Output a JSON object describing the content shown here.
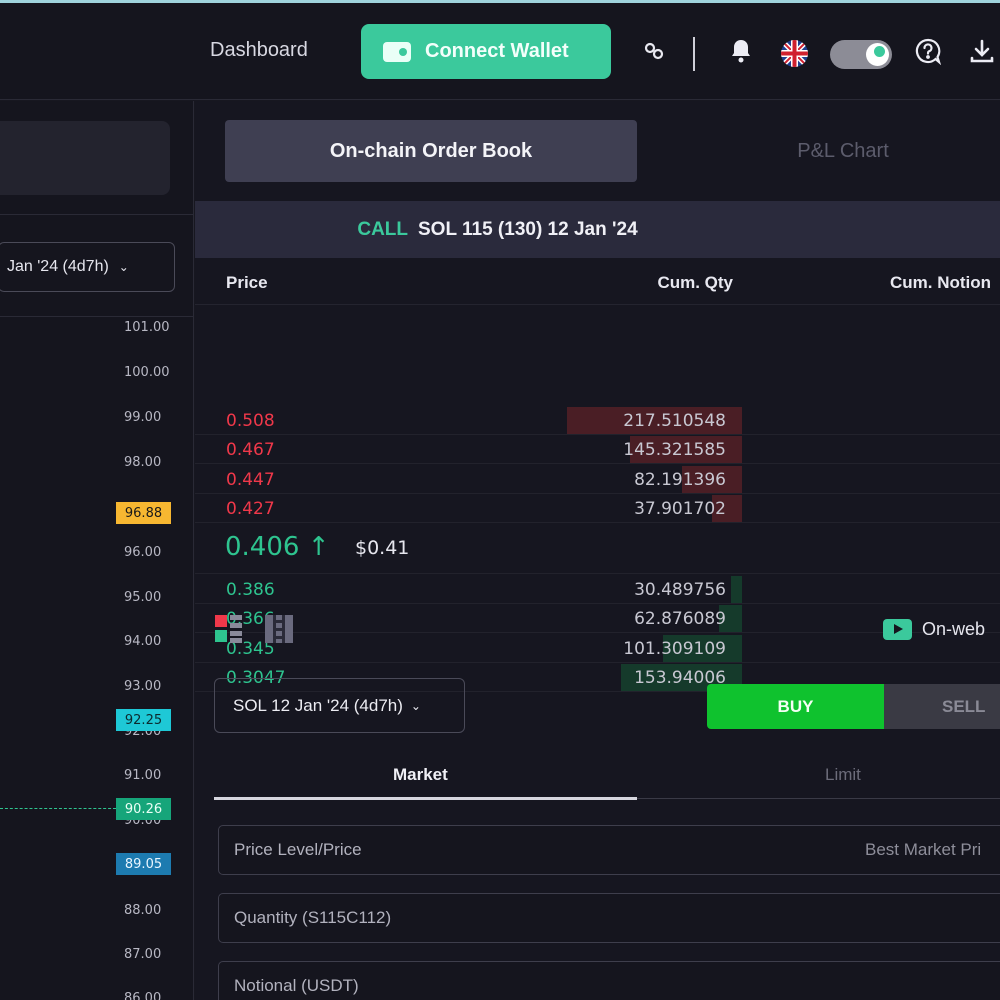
{
  "header": {
    "dashboard_label": "Dashboard",
    "connect_wallet_label": "Connect Wallet",
    "icons": [
      "link-icon",
      "bell-icon",
      "uk-flag-icon",
      "theme-toggle",
      "help-icon",
      "download-icon"
    ]
  },
  "left_panel": {
    "expiry_label": "Jan '24 (4d7h)",
    "axis_ticks": [
      "101.00",
      "100.00",
      "99.00",
      "98.00",
      "96.00",
      "95.00",
      "94.00",
      "93.00",
      "92.00",
      "91.00",
      "90.00",
      "88.00",
      "87.00",
      "86.00"
    ],
    "price_tags": [
      {
        "label": "96.88",
        "bg": "#f7b731",
        "fg": "#1a1a1a"
      },
      {
        "label": "92.25",
        "bg": "#1ec8d6",
        "fg": "#0c2a2e"
      },
      {
        "label": "90.26",
        "bg": "#16a57a",
        "fg": "#eafff6"
      },
      {
        "label": "89.05",
        "bg": "#1d7bb0",
        "fg": "#eaf6ff"
      }
    ]
  },
  "tabs": {
    "order_book": "On-chain Order Book",
    "pnl_chart": "P&L Chart"
  },
  "instrument": {
    "type": "CALL",
    "name": "SOL 115 (130) 12 Jan '24"
  },
  "order_book": {
    "columns": {
      "price": "Price",
      "cum_qty": "Cum. Qty",
      "cum_notional": "Cum. Notion"
    },
    "asks": [
      {
        "price": "0.508",
        "qty": "217.510548",
        "depth": 1.0
      },
      {
        "price": "0.467",
        "qty": "145.321585",
        "depth": 0.64
      },
      {
        "price": "0.447",
        "qty": "82.191396",
        "depth": 0.34
      },
      {
        "price": "0.427",
        "qty": "37.901702",
        "depth": 0.17
      }
    ],
    "last_price": "0.406",
    "last_price_usd": "$0.41",
    "bids": [
      {
        "price": "0.386",
        "qty": "30.489756",
        "depth": 0.06
      },
      {
        "price": "0.366",
        "qty": "62.876089",
        "depth": 0.13
      },
      {
        "price": "0.345",
        "qty": "101.309109",
        "depth": 0.45
      },
      {
        "price": "0.3047",
        "qty": "153.94006",
        "depth": 0.69
      }
    ]
  },
  "colors": {
    "accent": "#3bc99c",
    "ask": "#f0384a",
    "bid": "#2ec48f",
    "buy": "#0fc22e"
  },
  "trade": {
    "onweb_label": "On-web",
    "expiry_label": "SOL 12 Jan '24 (4d7h)",
    "buy_label": "BUY",
    "sell_label": "SELL",
    "tab_market": "Market",
    "tab_limit": "Limit",
    "price_label": "Price Level/Price",
    "price_value": "Best Market Pri",
    "quantity_label": "Quantity (S115C112)",
    "notional_label": "Notional (USDT)"
  }
}
